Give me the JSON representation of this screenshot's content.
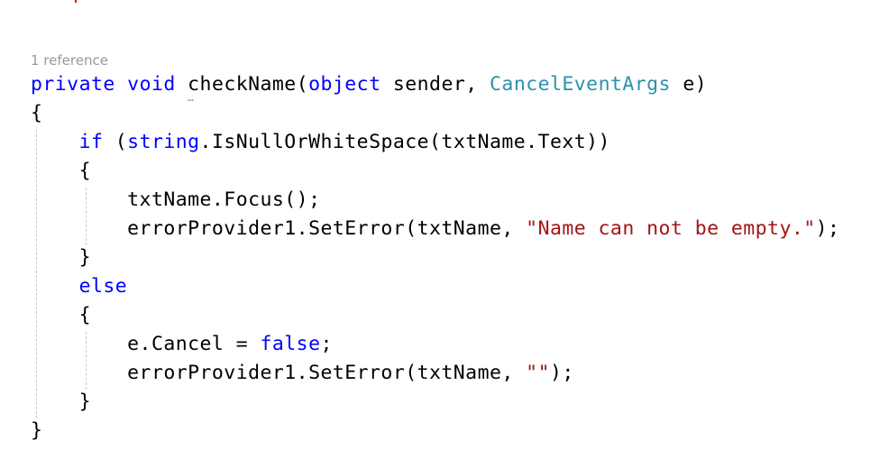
{
  "codelens": {
    "references": "1 reference"
  },
  "lines": [
    [
      {
        "kind": "kw",
        "text": "private"
      },
      {
        "kind": "plain",
        "text": " "
      },
      {
        "kind": "kw",
        "text": "void"
      },
      {
        "kind": "plain",
        "text": " "
      },
      {
        "kind": "method",
        "text": "checkName"
      },
      {
        "kind": "plain",
        "text": "("
      },
      {
        "kind": "kw",
        "text": "object"
      },
      {
        "kind": "plain",
        "text": " sender, "
      },
      {
        "kind": "type",
        "text": "CancelEventArgs"
      },
      {
        "kind": "plain",
        "text": " e)"
      }
    ],
    [
      {
        "kind": "plain",
        "text": "{"
      }
    ],
    [
      {
        "kind": "plain",
        "text": "    "
      },
      {
        "kind": "kw",
        "text": "if"
      },
      {
        "kind": "plain",
        "text": " ("
      },
      {
        "kind": "kw",
        "text": "string"
      },
      {
        "kind": "plain",
        "text": ".IsNullOrWhiteSpace(txtName.Text))"
      }
    ],
    [
      {
        "kind": "plain",
        "text": "    {"
      }
    ],
    [
      {
        "kind": "plain",
        "text": "        txtName.Focus();"
      }
    ],
    [
      {
        "kind": "plain",
        "text": "        errorProvider1.SetError(txtName, "
      },
      {
        "kind": "str",
        "text": "\"Name can not be empty.\""
      },
      {
        "kind": "plain",
        "text": ");"
      }
    ],
    [
      {
        "kind": "plain",
        "text": "    }"
      }
    ],
    [
      {
        "kind": "plain",
        "text": "    "
      },
      {
        "kind": "kw",
        "text": "else"
      }
    ],
    [
      {
        "kind": "plain",
        "text": "    {"
      }
    ],
    [
      {
        "kind": "plain",
        "text": "        e.Cancel = "
      },
      {
        "kind": "kw",
        "text": "false"
      },
      {
        "kind": "plain",
        "text": ";"
      }
    ],
    [
      {
        "kind": "plain",
        "text": "        errorProvider1.SetError(txtName, "
      },
      {
        "kind": "str",
        "text": "\"\""
      },
      {
        "kind": "plain",
        "text": ");"
      }
    ],
    [
      {
        "kind": "plain",
        "text": "    }"
      }
    ],
    [
      {
        "kind": "plain",
        "text": "}"
      }
    ]
  ],
  "colors": {
    "keyword": "#0000ff",
    "type": "#2b91af",
    "string": "#a31515",
    "codelens": "#999999",
    "error_marker": "#e51400"
  }
}
